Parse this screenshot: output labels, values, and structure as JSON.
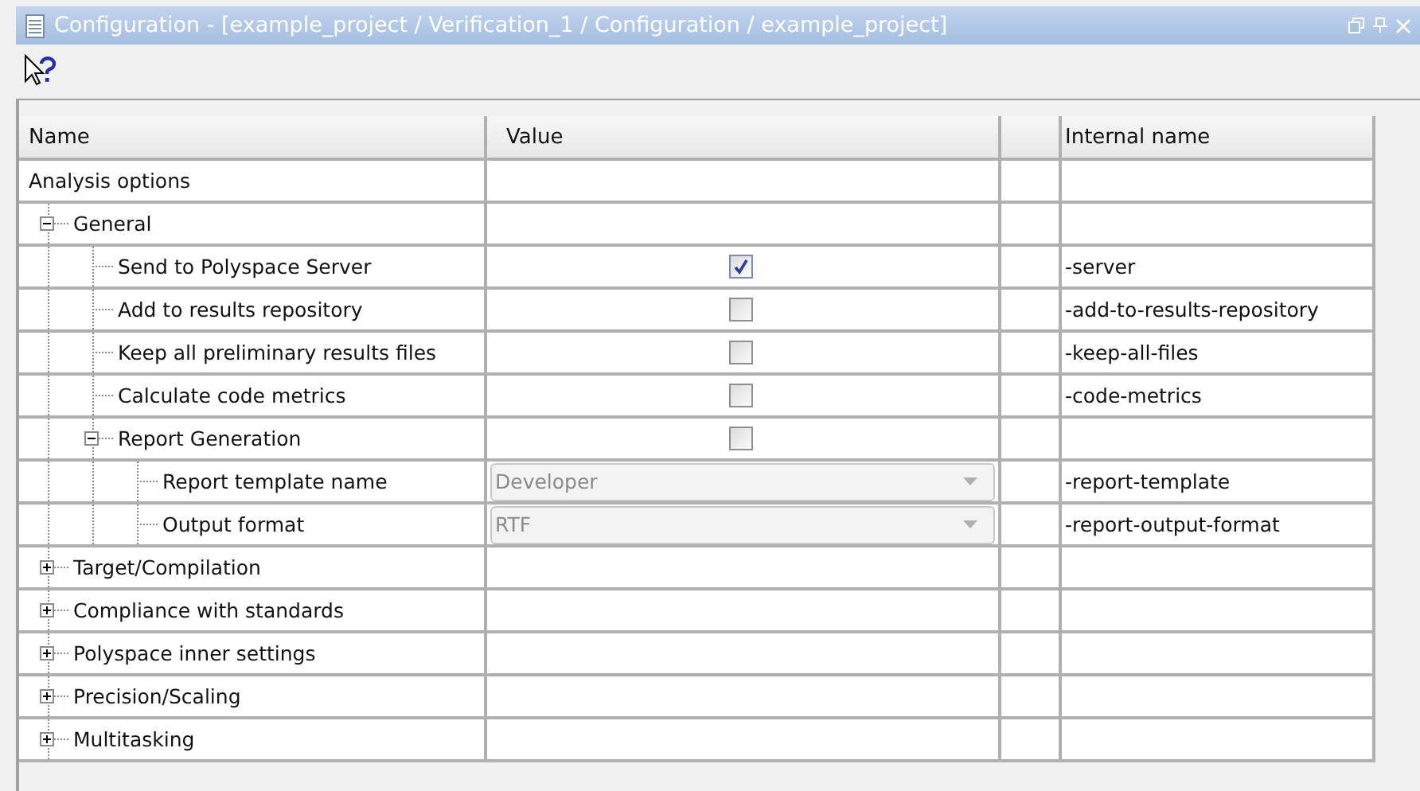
{
  "window": {
    "title": "Configuration - [example_project / Verification_1 / Configuration / example_project]"
  },
  "table": {
    "columns": [
      "Name",
      "Value",
      "Internal name"
    ],
    "tree": [
      {
        "label": "Analysis options",
        "children": [
          {
            "label": "General",
            "expanded": true,
            "children": [
              {
                "label": "Send to Polyspace Server",
                "kind": "checkbox",
                "checked": true,
                "internal_name": "-server"
              },
              {
                "label": "Add to results repository",
                "kind": "checkbox",
                "checked": false,
                "internal_name": "-add-to-results-repository"
              },
              {
                "label": "Keep all preliminary results files",
                "kind": "checkbox",
                "checked": false,
                "internal_name": "-keep-all-files"
              },
              {
                "label": "Calculate code metrics",
                "kind": "checkbox",
                "checked": false,
                "internal_name": "-code-metrics"
              },
              {
                "label": "Report Generation",
                "kind": "checkbox",
                "checked": false,
                "expanded": true,
                "children": [
                  {
                    "label": "Report template name",
                    "kind": "dropdown",
                    "value": "Developer",
                    "disabled": true,
                    "internal_name": "-report-template"
                  },
                  {
                    "label": "Output format",
                    "kind": "dropdown",
                    "value": "RTF",
                    "disabled": true,
                    "internal_name": "-report-output-format"
                  }
                ]
              }
            ]
          },
          {
            "label": "Target/Compilation",
            "expanded": false
          },
          {
            "label": "Compliance with standards",
            "expanded": false
          },
          {
            "label": "Polyspace inner settings",
            "expanded": false
          },
          {
            "label": "Precision/Scaling",
            "expanded": false
          },
          {
            "label": "Multitasking",
            "expanded": false
          }
        ]
      }
    ]
  }
}
